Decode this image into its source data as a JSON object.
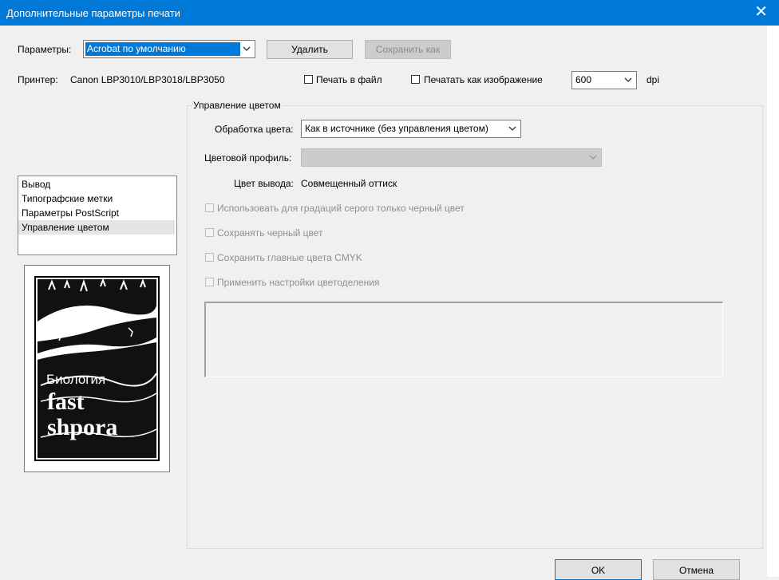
{
  "window": {
    "title": "Дополнительные параметры печати",
    "close_glyph": "✕"
  },
  "params": {
    "label": "Параметры:",
    "selected": "Acrobat по умолчанию",
    "delete_label": "Удалить",
    "save_as_label": "Сохранить как"
  },
  "printer": {
    "label": "Принтер:",
    "name": "Canon LBP3010/LBP3018/LBP3050"
  },
  "options": {
    "print_to_file": "Печать в файл",
    "print_as_image": "Печатать как изображение",
    "dpi_value": "600",
    "dpi_unit": "dpi"
  },
  "sidebar": {
    "items": [
      "Вывод",
      "Типографские метки",
      "Параметры PostScript",
      "Управление цветом"
    ],
    "selected_index": 3
  },
  "preview": {
    "line1": "Биология",
    "line2": "fast",
    "line3": "shpora"
  },
  "color": {
    "group_title": "Управление цветом",
    "handling_label": "Обработка цвета:",
    "handling_value": "Как в источнике (без управления цветом)",
    "profile_label": "Цветовой профиль:",
    "profile_value": "",
    "output_label": "Цвет вывода:",
    "output_value": "Совмещенный оттиск",
    "checks": [
      "Использовать для градаций серого только черный цвет",
      "Сохранять черный цвет",
      "Сохранить главные цвета CMYK",
      "Применить настройки цветоделения"
    ]
  },
  "footer": {
    "ok_label": "OK",
    "cancel_label": "Отмена"
  },
  "colors": {
    "accent": "#0078d7",
    "selection": "#0078d7",
    "disabled_text": "#8f8f8f"
  }
}
